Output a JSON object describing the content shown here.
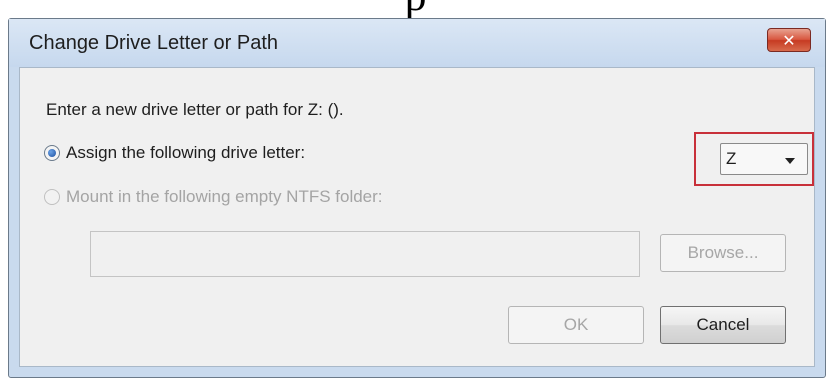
{
  "page_title_fragment": "p",
  "dialog": {
    "title": "Change Drive Letter or Path",
    "close_label": "✕",
    "prompt": "Enter a new drive letter or path for Z: ().",
    "assign_option_label": "Assign the following drive letter:",
    "assign_option_selected": true,
    "drive_letter_value": "Z",
    "mount_option_label": "Mount in the following empty NTFS folder:",
    "mount_option_enabled": false,
    "folder_path_value": "",
    "browse_label": "Browse...",
    "ok_label": "OK",
    "cancel_label": "Cancel"
  },
  "colors": {
    "highlight_box": "#c8303a",
    "close_button": "#d8563f",
    "title_bar": "#c9daee"
  }
}
